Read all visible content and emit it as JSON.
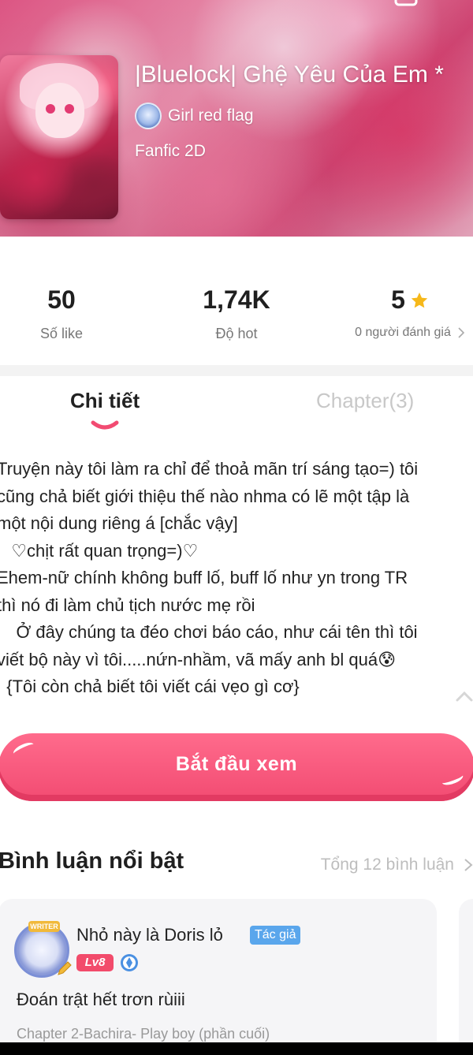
{
  "header": {
    "title": "|Bluelock| Ghệ Yêu Của Em *",
    "author_name": "Girl red flag",
    "genre": "Fanfic 2D",
    "colors": {
      "accent": "#f24b72",
      "header_pink": "#e85a8a"
    }
  },
  "stats": {
    "likes": {
      "value": "50",
      "label": "Số like"
    },
    "hot": {
      "value": "1,74K",
      "label": "Độ hot"
    },
    "rating": {
      "value": "5",
      "label": "0 người đánh giá"
    }
  },
  "tabs": {
    "details": "Chi tiết",
    "chapters": "Chapter(3)"
  },
  "description": {
    "lines": [
      "Truyện này tôi làm ra chỉ để thoả mãn trí sáng tạo=) tôi",
      "cũng chả biết giới thiệu thế nào nhma có lẽ một tập là",
      "một nội dung riêng á [chắc vậy]",
      "   ♡chịt rất quan trọng=)♡",
      "Ehem-nữ chính không buff lố, buff lố như yn trong TR",
      "thì nó đi làm chủ tịch nước mẹ rồi",
      "    Ở đây chúng ta đéo chơi báo cáo, như cái tên thì tôi",
      "viết bộ này vì tôi.....nứn-nhầm, vã mấy anh bl quá😰",
      "  {Tôi còn chả biết tôi viết cái vẹo gì cơ}"
    ]
  },
  "start_button": {
    "label": "Bắt đầu xem"
  },
  "comments": {
    "title": "Bình luận nổi bật",
    "total": "Tổng 12 bình luận",
    "items": [
      {
        "badge": "WRITER",
        "name": "Nhỏ này là Doris lỏ",
        "tag": "Tác giả",
        "level": "Lv8",
        "text": "Đoán trật hết trơn rùiii",
        "chapter": "Chapter 2-Bachira- Play boy (phần cuối)"
      }
    ]
  }
}
